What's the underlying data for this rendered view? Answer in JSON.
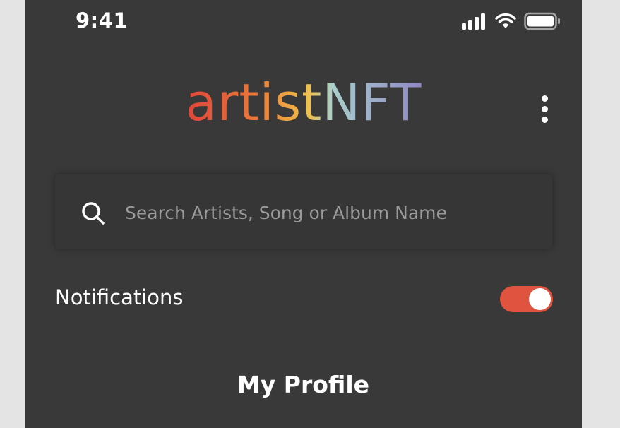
{
  "status_bar": {
    "time": "9:41"
  },
  "header": {
    "logo": {
      "part1": "artist",
      "part2": "NFT"
    },
    "menu_icon": "more-vertical-icon"
  },
  "search": {
    "placeholder": "Search Artists, Song or Album Name",
    "value": "",
    "icon": "search-icon"
  },
  "settings": {
    "notifications_label": "Notifications",
    "notifications_on": true
  },
  "profile": {
    "title": "My Profile"
  },
  "colors": {
    "background": "#393939",
    "toggle_on": "#e0533f",
    "logo_gradient": [
      "#e0443b",
      "#ea7a3a",
      "#f0c04a",
      "#a9cfcb",
      "#8f86c4"
    ]
  }
}
